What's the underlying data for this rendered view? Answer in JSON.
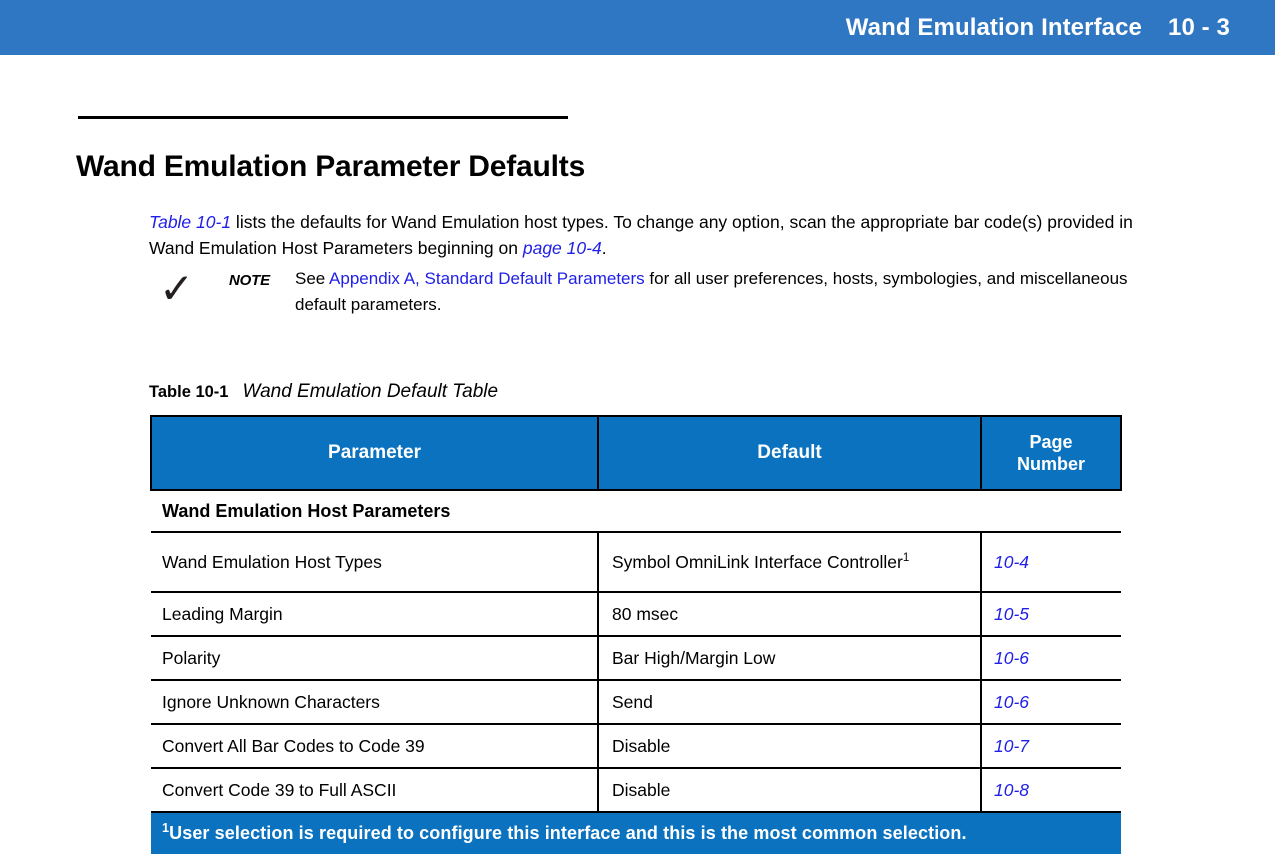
{
  "header": {
    "title": "Wand Emulation Interface",
    "page_number": "10 - 3"
  },
  "section": {
    "title": "Wand Emulation Parameter Defaults"
  },
  "intro": {
    "link_table": "Table 10-1",
    "text_1": " lists the defaults for Wand Emulation host types. To change any option, scan the appropriate bar code(s) provided in Wand Emulation Host Parameters beginning on ",
    "link_page": "page 10-4",
    "text_2": "."
  },
  "note": {
    "icon": "checkmark-icon",
    "label": "NOTE",
    "text_1": "See ",
    "link": "Appendix A, Standard Default Parameters",
    "text_2": " for all user preferences, hosts, symbologies, and miscellaneous default parameters."
  },
  "table": {
    "caption_number": "Table 10-1",
    "caption_title": "Wand Emulation Default Table",
    "columns": [
      "Parameter",
      "Default",
      "Page Number"
    ],
    "column_page_line1": "Page",
    "column_page_line2": "Number",
    "section_row": "Wand Emulation Host Parameters",
    "rows": [
      {
        "parameter": "Wand Emulation Host Types",
        "default": "Symbol OmniLink Interface Controller",
        "default_superscript": "1",
        "page": "10-4"
      },
      {
        "parameter": "Leading Margin",
        "default": "80 msec",
        "default_superscript": "",
        "page": "10-5"
      },
      {
        "parameter": "Polarity",
        "default": "Bar High/Margin Low",
        "default_superscript": "",
        "page": "10-6"
      },
      {
        "parameter": "Ignore Unknown Characters",
        "default": "Send",
        "default_superscript": "",
        "page": "10-6"
      },
      {
        "parameter": "Convert All Bar Codes to Code 39",
        "default": "Disable",
        "default_superscript": "",
        "page": "10-7"
      },
      {
        "parameter": "Convert Code 39 to Full ASCII",
        "default": "Disable",
        "default_superscript": "",
        "page": "10-8"
      }
    ],
    "footnote_marker": "1",
    "footnote": "User selection is required to configure this interface and this is the most common selection."
  },
  "colors": {
    "header_bar_blue": "#2f76c3",
    "table_blue": "#0b72bf",
    "link_blue": "#2020e8"
  }
}
